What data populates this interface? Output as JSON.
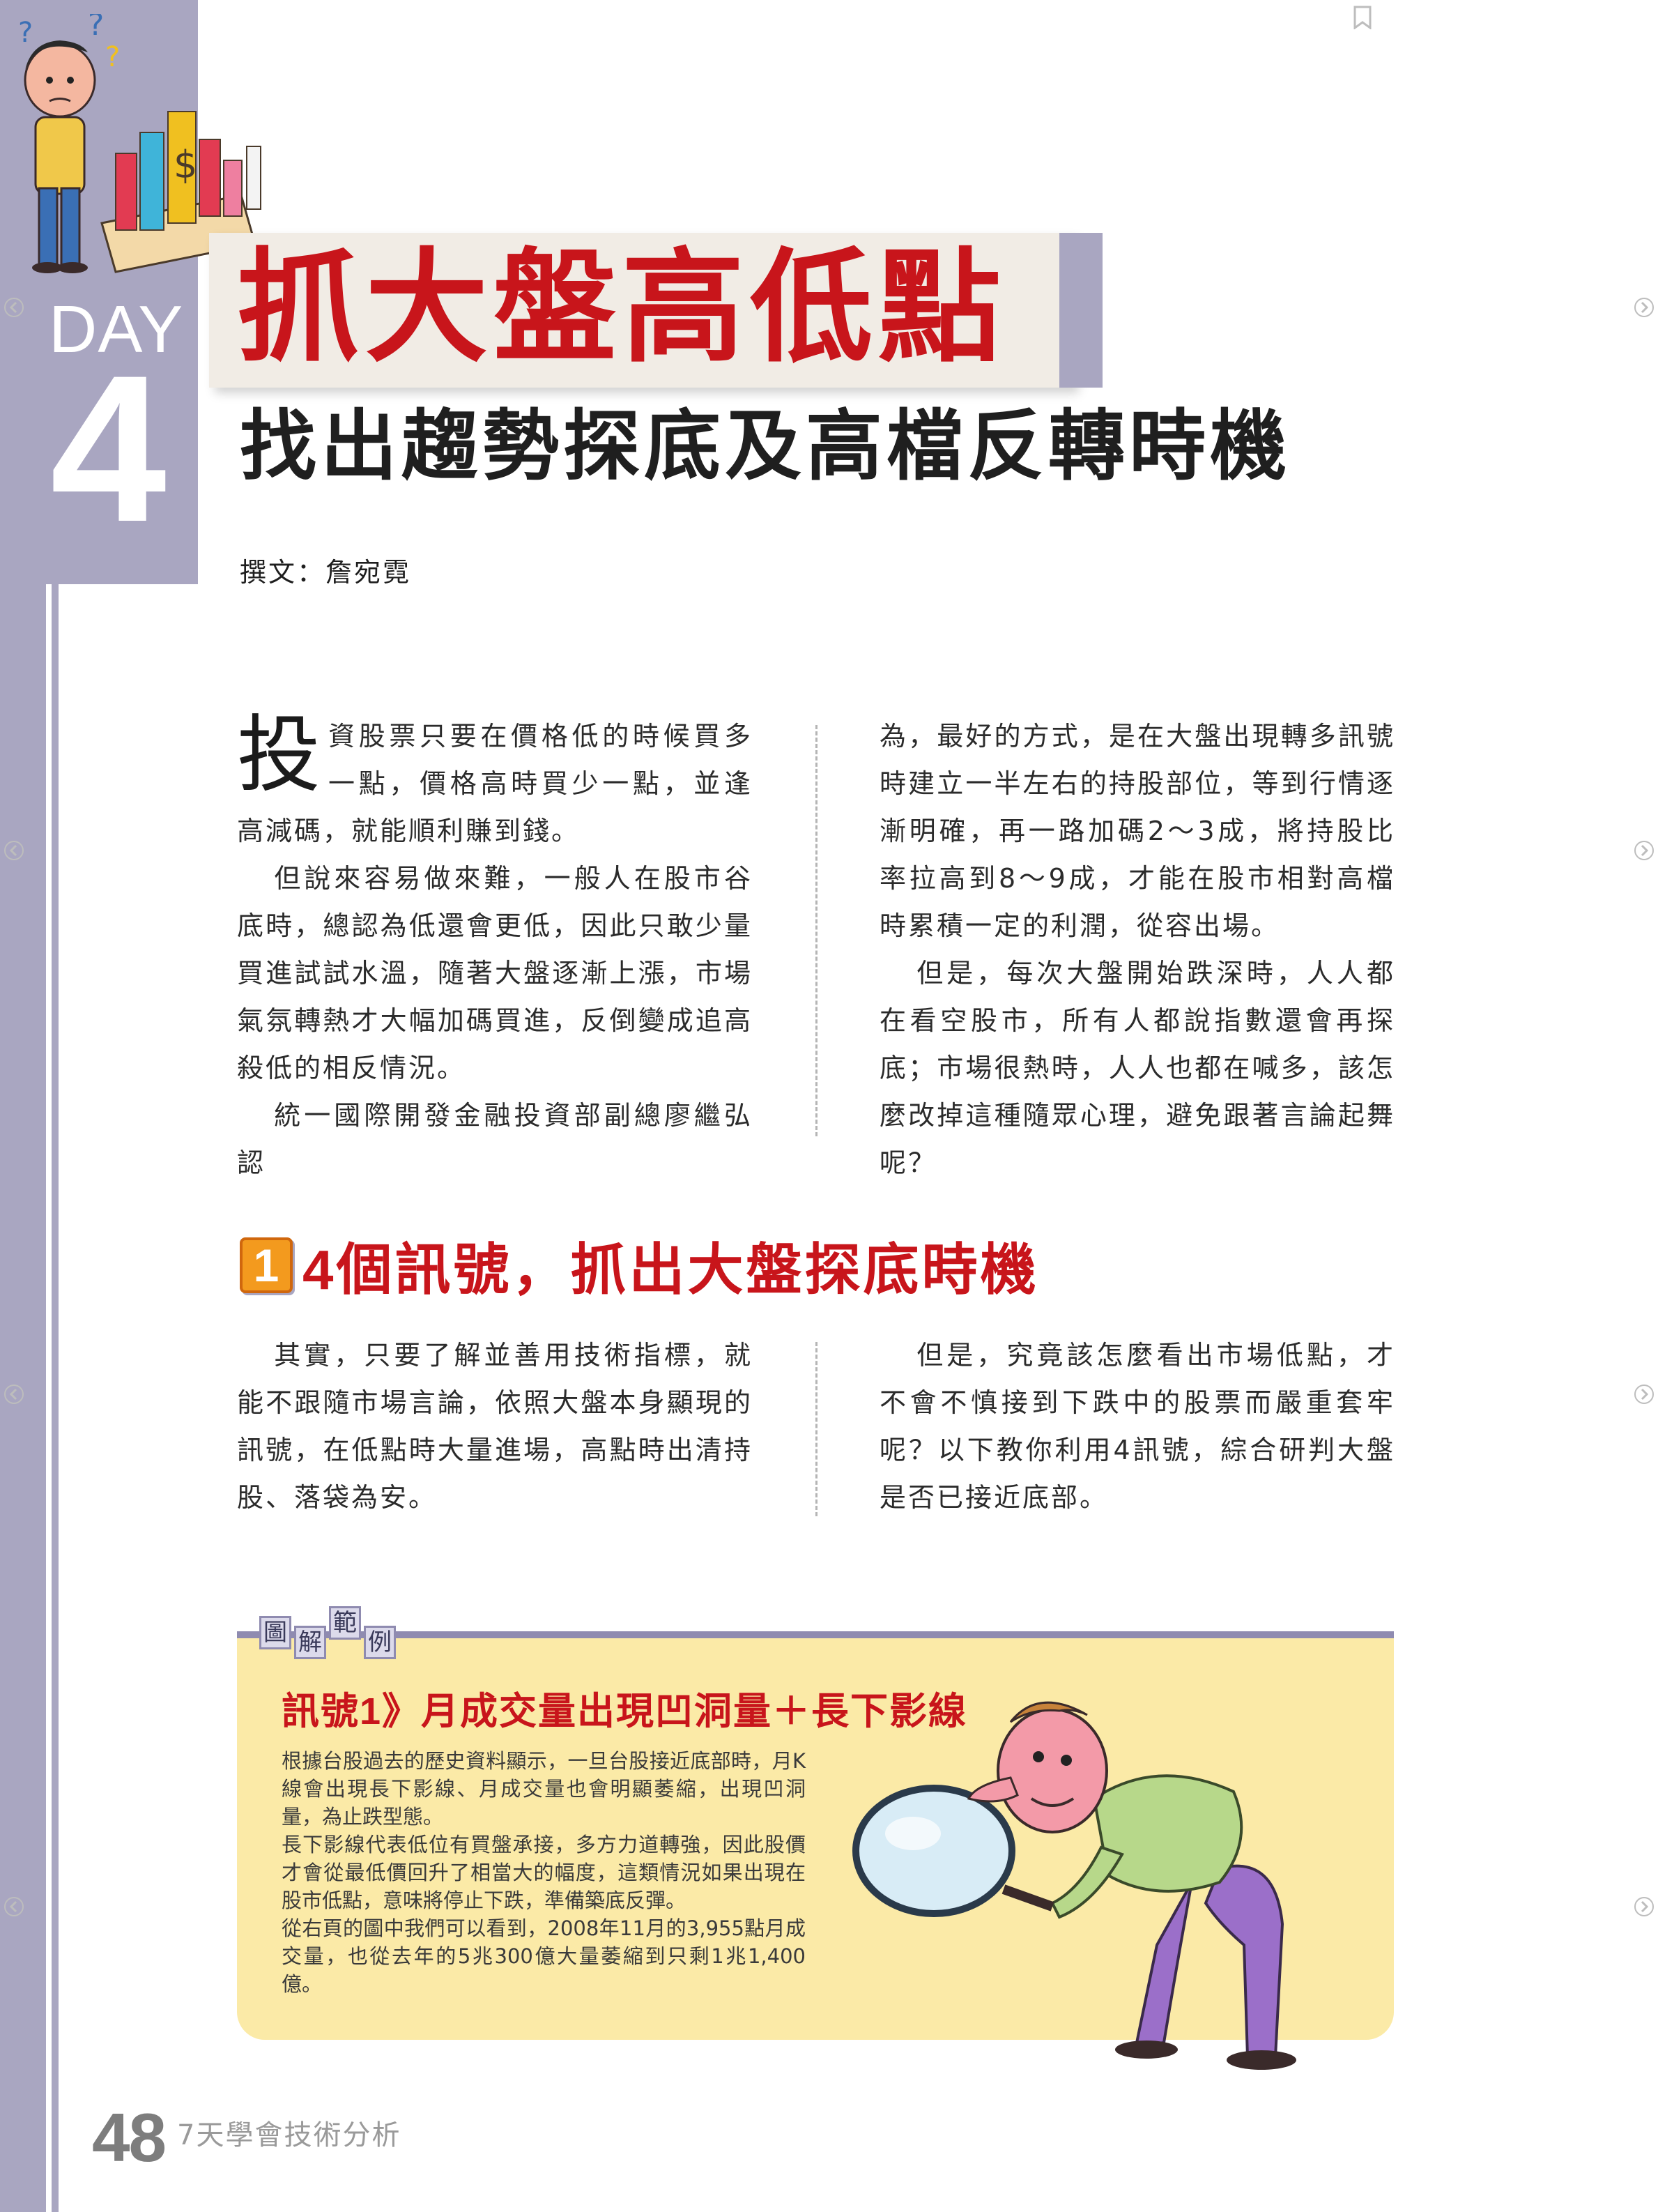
{
  "header": {
    "day_label": "DAY",
    "day_number": "4",
    "title": "抓大盤高低點",
    "subtitle": "找出趨勢探底及高檔反轉時機",
    "byline": "撰文：詹宛霓"
  },
  "intro": {
    "dropcap": "投",
    "left_paragraphs": [
      "資股票只要在價格低的時候買多一點，價格高時買少一點，並逢高減碼，就能順利賺到錢。",
      "但說來容易做來難，一般人在股市谷底時，總認為低還會更低，因此只敢少量買進試試水溫，隨著大盤逐漸上漲，市場氣氛轉熱才大幅加碼買進，反倒變成追高殺低的相反情況。",
      "統一國際開發金融投資部副總廖繼弘認"
    ],
    "right_paragraphs": [
      "為，最好的方式，是在大盤出現轉多訊號時建立一半左右的持股部位，等到行情逐漸明確，再一路加碼2～3成，將持股比率拉高到8～9成，才能在股市相對高檔時累積一定的利潤，從容出場。",
      "但是，每次大盤開始跌深時，人人都在看空股市，所有人都說指數還會再探底；市場很熱時，人人也都在喊多，該怎麼改掉這種隨眾心理，避免跟著言論起舞呢？"
    ]
  },
  "section1": {
    "number": "1",
    "title": "4個訊號，抓出大盤探底時機",
    "left_paragraph": "其實，只要了解並善用技術指標，就能不跟隨市場言論，依照大盤本身顯現的訊號，在低點時大量進場，高點時出清持股、落袋為安。",
    "right_paragraph": "但是，究竟該怎麼看出市場低點，才不會不慎接到下跌中的股票而嚴重套牢呢？以下教你利用4訊號，綜合研判大盤是否已接近底部。"
  },
  "example": {
    "tag_chars": [
      "圖",
      "解",
      "範",
      "例"
    ],
    "signal_title": "訊號1》月成交量出現凹洞量＋長下影線",
    "paragraphs": [
      "根據台股過去的歷史資料顯示，一旦台股接近底部時，月K線會出現長下影線、月成交量也會明顯萎縮，出現凹洞量，為止跌型態。",
      "長下影線代表低位有買盤承接，多方力道轉強，因此股價才會從最低價回升了相當大的幅度，這類情況如果出現在股市低點，意味將停止下跌，準備築底反彈。",
      "從右頁的圖中我們可以看到，2008年11月的3,955點月成交量，也從去年的5兆300億大量萎縮到只剩1兆1,400億。"
    ]
  },
  "footer": {
    "page_number": "48",
    "book_title": "7天學會技術分析"
  },
  "colors": {
    "accent_purple": "#a9a6c1",
    "title_red": "#c8151b",
    "box_yellow": "#fbeaa7",
    "badge_orange": "#f39a1e"
  },
  "icons": {
    "bookmark": "bookmark-icon",
    "nav_left": "chevron-left-icon",
    "nav_right": "chevron-right-icon"
  }
}
